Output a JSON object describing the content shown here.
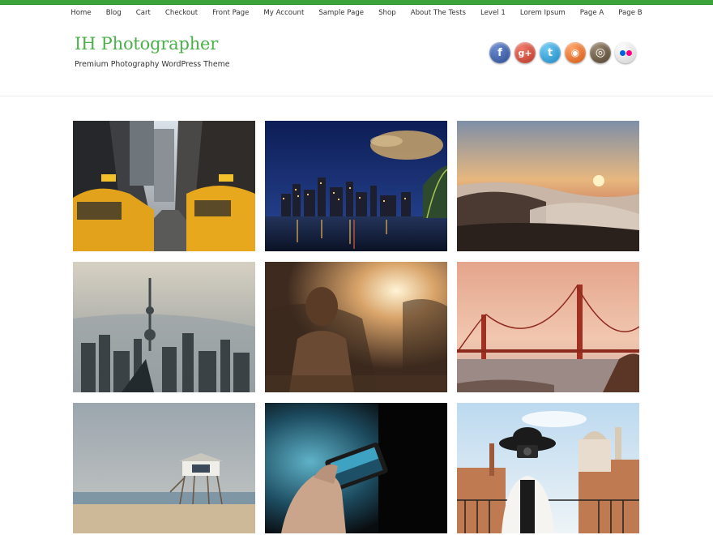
{
  "nav": {
    "items": [
      "Home",
      "Blog",
      "Cart",
      "Checkout",
      "Front Page",
      "My Account",
      "Sample Page",
      "Shop",
      "About The Tests",
      "Level 1",
      "Lorem Ipsum",
      "Page A",
      "Page B"
    ]
  },
  "header": {
    "title": "IH Photographer",
    "tagline": "Premium Photography WordPress Theme"
  },
  "social": [
    {
      "name": "facebook-icon",
      "glyph": "f",
      "color": "#3b5998"
    },
    {
      "name": "google-plus-icon",
      "glyph": "g+",
      "color": "#d34836"
    },
    {
      "name": "twitter-icon",
      "glyph": "t",
      "color": "#2aa3dd"
    },
    {
      "name": "rss-icon",
      "glyph": "◉",
      "color": "#e8621c"
    },
    {
      "name": "instagram-icon",
      "glyph": "◎",
      "color": "#6b5a45"
    },
    {
      "name": "flickr-icon",
      "glyph": "●●",
      "color": "#e9e9e9"
    }
  ],
  "gallery": [
    {
      "name": "photo-city-taxis"
    },
    {
      "name": "photo-night-skyline"
    },
    {
      "name": "photo-sunset-fog-hills"
    },
    {
      "name": "photo-foggy-city-tower"
    },
    {
      "name": "photo-woman-sunset"
    },
    {
      "name": "photo-golden-gate-bridge"
    },
    {
      "name": "photo-lifeguard-tower-beach"
    },
    {
      "name": "photo-hand-phone-camera"
    },
    {
      "name": "photo-woman-camera-rooftops"
    }
  ]
}
